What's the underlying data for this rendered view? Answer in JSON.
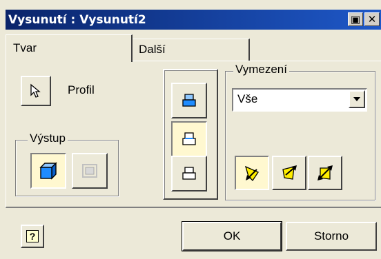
{
  "window": {
    "title": "Vysunutí : Vysunutí2",
    "restore_glyph": "▣",
    "close_glyph": "✕"
  },
  "tabs": [
    {
      "label": "Tvar",
      "active": true
    },
    {
      "label": "Další",
      "active": false
    }
  ],
  "profile": {
    "label": "Profil",
    "icon": "cursor-arrow-icon"
  },
  "output": {
    "group_label": "Výstup",
    "buttons": [
      {
        "icon": "solid-cube-icon",
        "selected": true,
        "enabled": true
      },
      {
        "icon": "surface-icon",
        "selected": false,
        "enabled": false
      }
    ]
  },
  "operations": [
    {
      "icon": "join-icon",
      "selected": false
    },
    {
      "icon": "cut-icon",
      "selected": true
    },
    {
      "icon": "intersect-icon",
      "selected": false
    }
  ],
  "extents": {
    "group_label": "Vymezení",
    "selected_value": "Vše",
    "directions": [
      {
        "icon": "direction-1-icon",
        "selected": true
      },
      {
        "icon": "direction-2-icon",
        "selected": false
      },
      {
        "icon": "symmetric-icon",
        "selected": false
      }
    ]
  },
  "footer": {
    "help_glyph": "?",
    "ok_label": "OK",
    "cancel_label": "Storno"
  },
  "colors": {
    "titlebar": "#0a246a",
    "face": "#ece9d8",
    "selected_button": "#fff8d0",
    "solid_blue": "#1e8cff",
    "yellow": "#ffee00"
  }
}
